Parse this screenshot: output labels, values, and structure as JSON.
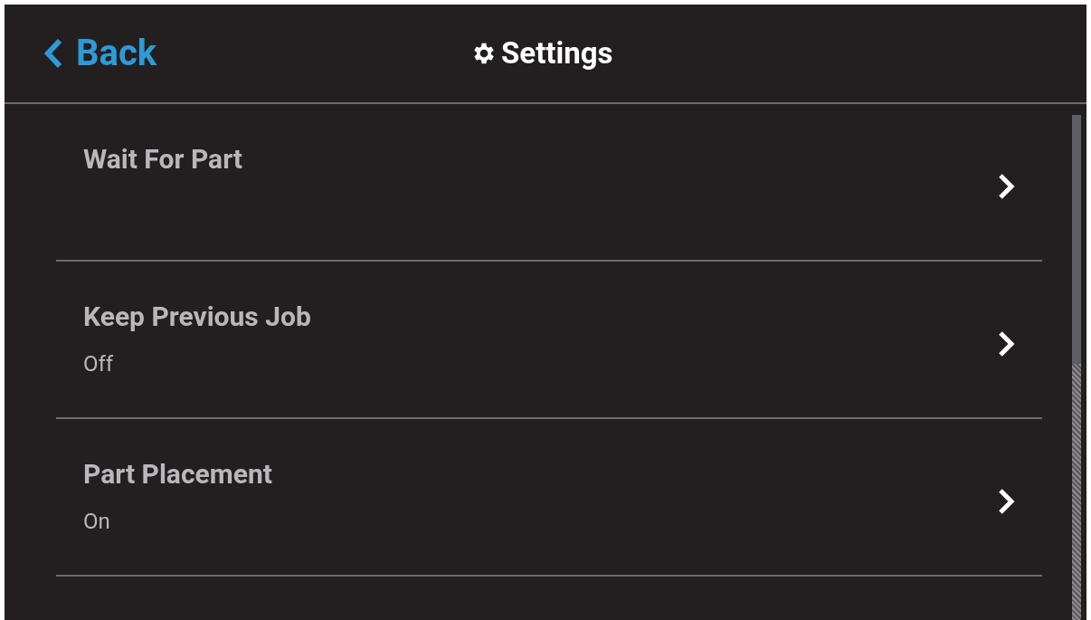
{
  "header": {
    "back": "Back",
    "title": "Settings"
  },
  "items": [
    {
      "label": "Wait For Part"
    },
    {
      "label": "Keep Previous Job",
      "value": "Off"
    },
    {
      "label": "Part Placement",
      "value": "On"
    }
  ]
}
